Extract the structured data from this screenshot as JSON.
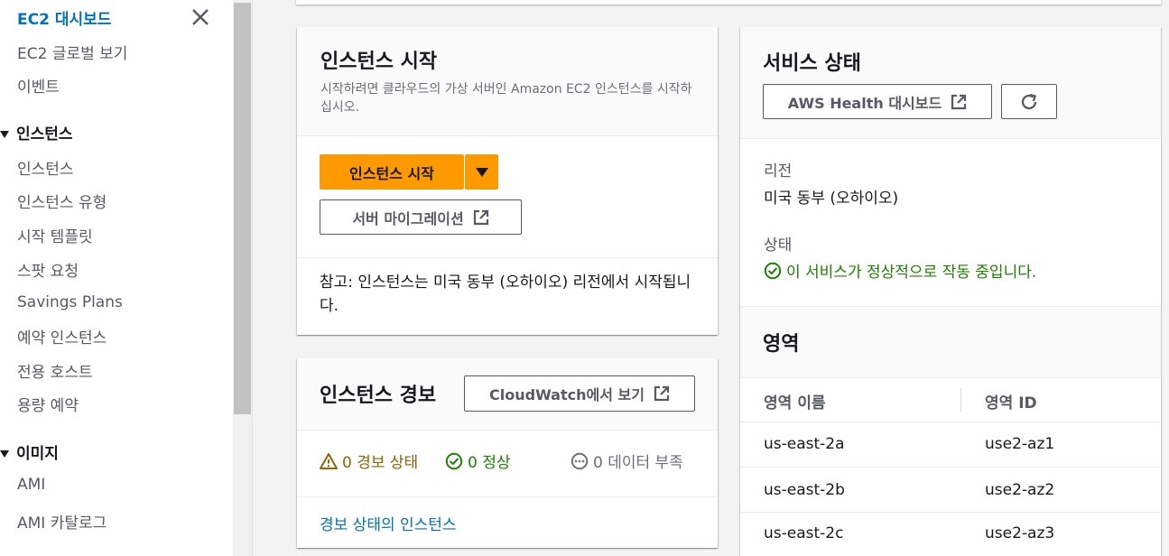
{
  "sidebar": {
    "items_top": [
      "EC2 대시보드",
      "EC2 글로벌 보기",
      "이벤트"
    ],
    "section_instances": "인스턴스",
    "instances_items": [
      "인스턴스",
      "인스턴스 유형",
      "시작 템플릿",
      "스팟 요청",
      "Savings Plans",
      "예약 인스턴스",
      "전용 호스트",
      "용량 예약"
    ],
    "section_images": "이미지",
    "images_items": [
      "AMI",
      "AMI 카탈로그"
    ]
  },
  "launch": {
    "title": "인스턴스 시작",
    "desc": "시작하려면 클라우드의 가상 서버인 Amazon EC2 인스턴스를 시작하십시오.",
    "primary_label": "인스턴스 시작",
    "migrate_label": "서버 마이그레이션",
    "note": "참고: 인스턴스는 미국 동부 (오하이오) 리전에서 시작됩니다."
  },
  "alarms": {
    "title": "인스턴스 경보",
    "cloudwatch_label": "CloudWatch에서 보기",
    "alarm_state": "0 경보 상태",
    "ok": "0 정상",
    "insufficient": "0 데이터 부족",
    "link": "경보 상태의 인스턴스"
  },
  "service": {
    "title": "서비스 상태",
    "health_label": "AWS Health 대시보드",
    "region_label": "리전",
    "region_value": "미국 동부 (오하이오)",
    "status_label": "상태",
    "status_value": "이 서비스가 정상적으로 작동 중입니다."
  },
  "zones": {
    "title": "영역",
    "col_name": "영역 이름",
    "col_id": "영역 ID",
    "rows": [
      {
        "name": "us-east-2a",
        "id": "use2-az1"
      },
      {
        "name": "us-east-2b",
        "id": "use2-az2"
      },
      {
        "name": "us-east-2c",
        "id": "use2-az3"
      }
    ]
  },
  "colors": {
    "link_blue": "#0073bb",
    "primary_orange": "#ff9900",
    "ok_green": "#1d8102",
    "warning_brown": "#8d6605"
  }
}
